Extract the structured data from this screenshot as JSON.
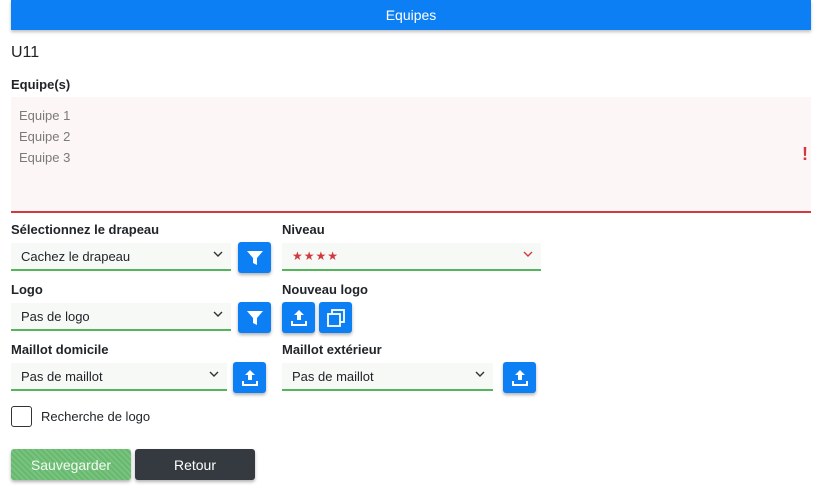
{
  "header": {
    "title": "Equipes"
  },
  "category": "U11",
  "teams": {
    "label": "Equipe(s)",
    "lines": [
      "Equipe 1",
      "Equipe 2",
      "Equipe 3"
    ],
    "warning": "!"
  },
  "flag": {
    "label": "Sélectionnez le drapeau",
    "value": "Cachez le drapeau"
  },
  "level": {
    "label": "Niveau",
    "value": "★★★★"
  },
  "logo": {
    "label": "Logo",
    "value": "Pas de logo"
  },
  "new_logo": {
    "label": "Nouveau logo"
  },
  "home_jersey": {
    "label": "Maillot domicile",
    "value": "Pas de maillot"
  },
  "away_jersey": {
    "label": "Maillot extérieur",
    "value": "Pas de maillot"
  },
  "logo_search": {
    "label": "Recherche de logo",
    "checked": false
  },
  "actions": {
    "save": "Sauvegarder",
    "back": "Retour"
  },
  "colors": {
    "primary": "#0d7ff5",
    "success": "#54b55c",
    "danger": "#d0393e",
    "dark": "#343a40"
  },
  "icons": {
    "filter": "filter-icon",
    "upload": "upload-icon",
    "gallery": "gallery-icon",
    "chevron": "chevron-down-icon"
  }
}
